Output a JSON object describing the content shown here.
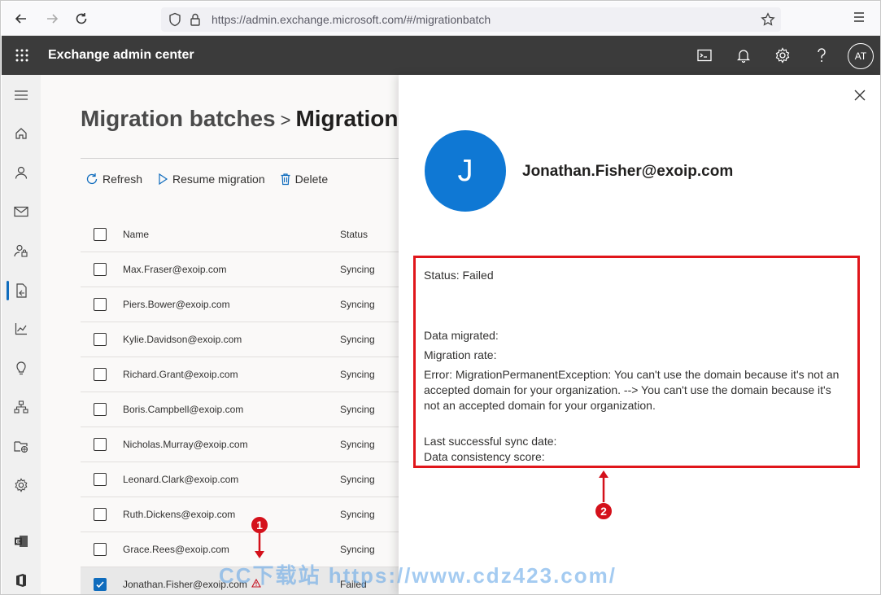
{
  "browser": {
    "url": "https://admin.exchange.microsoft.com/#/migrationbatch",
    "icons": [
      "back-arrow-icon",
      "forward-arrow-icon",
      "reload-icon",
      "shield-icon",
      "lock-icon",
      "star-icon",
      "menu-icon"
    ]
  },
  "appbar": {
    "title": "Exchange admin center",
    "avatar_initials": "AT",
    "icons": [
      "waffle-icon",
      "terminal-icon",
      "bell-icon",
      "gear-icon",
      "help-icon"
    ],
    "color": "#3b3b3b"
  },
  "rail": {
    "items": [
      "hamburger-icon",
      "home-icon",
      "person-icon",
      "mail-icon",
      "person-lock-icon",
      "migration-icon",
      "chart-icon",
      "lightbulb-icon",
      "org-icon",
      "folder-globe-icon",
      "settings-icon",
      "exchange-icon",
      "office-icon"
    ],
    "active_index": 5,
    "accent": "#0f6cbd"
  },
  "main": {
    "breadcrumb_root": "Migration batches",
    "breadcrumb_separator": ">",
    "breadcrumb_current": "MigrationB",
    "commands": [
      {
        "label": "Refresh",
        "icon": "refresh-icon"
      },
      {
        "label": "Resume migration",
        "icon": "play-icon"
      },
      {
        "label": "Delete",
        "icon": "trash-icon"
      }
    ],
    "columns": [
      "Name",
      "Status"
    ],
    "rows": [
      {
        "name": "Max.Fraser@exoip.com",
        "status": "Syncing",
        "checked": false
      },
      {
        "name": "Piers.Bower@exoip.com",
        "status": "Syncing",
        "checked": false
      },
      {
        "name": "Kylie.Davidson@exoip.com",
        "status": "Syncing",
        "checked": false
      },
      {
        "name": "Richard.Grant@exoip.com",
        "status": "Syncing",
        "checked": false
      },
      {
        "name": "Boris.Campbell@exoip.com",
        "status": "Syncing",
        "checked": false
      },
      {
        "name": "Nicholas.Murray@exoip.com",
        "status": "Syncing",
        "checked": false
      },
      {
        "name": "Leonard.Clark@exoip.com",
        "status": "Syncing",
        "checked": false
      },
      {
        "name": "Ruth.Dickens@exoip.com",
        "status": "Syncing",
        "checked": false
      },
      {
        "name": "Grace.Rees@exoip.com",
        "status": "Syncing",
        "checked": false
      },
      {
        "name": "Jonathan.Fisher@exoip.com",
        "status": "Failed",
        "checked": true,
        "warning": true
      }
    ]
  },
  "panel": {
    "avatar_letter": "J",
    "avatar_color": "#0f78d4",
    "user": "Jonathan.Fisher@exoip.com",
    "status": "Status: Failed",
    "data_migrated": "Data migrated:",
    "migration_rate": "Migration rate:",
    "error": "Error: MigrationPermanentException: You can't use the domain because it's not an accepted domain for your organization. --> You can't use the domain because it's not an accepted domain for your organization.",
    "last_sync": "Last successful sync date:",
    "consistency": "Data consistency score:",
    "highlight_color": "#e0161b"
  },
  "annotations": {
    "callout_1": "1",
    "callout_2": "2",
    "color": "#d4111b"
  },
  "watermark": "CC下载站 https://www.cdz423.com/"
}
